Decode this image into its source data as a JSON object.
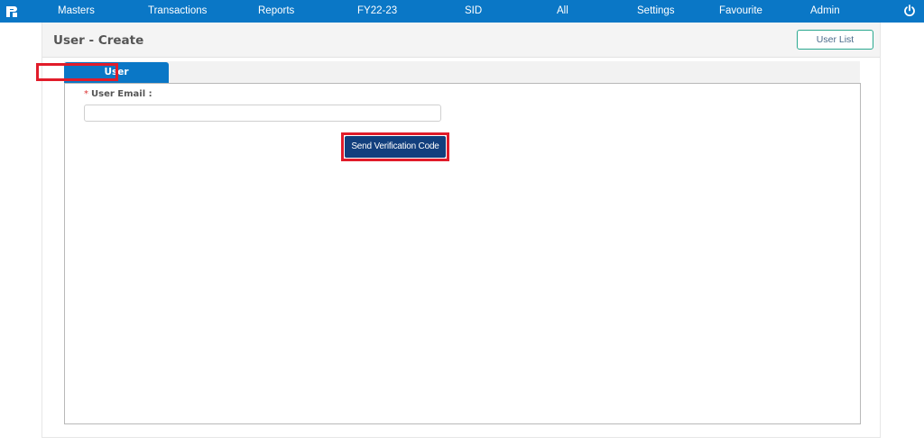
{
  "nav": {
    "items": [
      "Masters",
      "Transactions",
      "Reports",
      "FY22-23",
      "SID",
      "All",
      "Settings",
      "Favourite",
      "Admin"
    ]
  },
  "page": {
    "title": "User - Create",
    "user_list_label": "User List"
  },
  "tabs": [
    {
      "label": "User",
      "active": true
    }
  ],
  "form": {
    "email_label": "User Email :",
    "required_marker": "*",
    "email_value": "",
    "send_button_label": "Send Verification Code"
  },
  "colors": {
    "nav_bg": "#0a77c6",
    "tab_active": "#0a77c6",
    "send_button": "#123f7d",
    "highlight": "#e11c2a",
    "user_list_border": "#2aa88f"
  },
  "icons": {
    "logo": "app-logo-icon",
    "power": "power-icon"
  }
}
